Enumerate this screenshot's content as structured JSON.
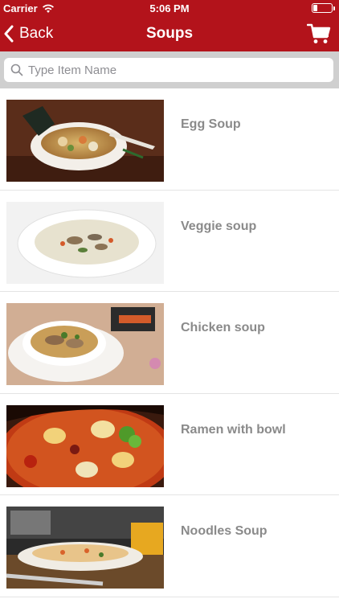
{
  "status": {
    "carrier": "Carrier",
    "time": "5:06 PM"
  },
  "nav": {
    "back_label": "Back",
    "title": "Soups",
    "cart_icon": "cart-icon"
  },
  "search": {
    "placeholder": "Type Item Name",
    "value": ""
  },
  "items": [
    {
      "label": "Egg Soup"
    },
    {
      "label": "Veggie soup"
    },
    {
      "label": "Chicken soup"
    },
    {
      "label": "Ramen with bowl"
    },
    {
      "label": "Noodles Soup"
    }
  ],
  "colors": {
    "accent": "#b3131b",
    "search_bg": "#cfcfcf",
    "item_text": "#8a8a8a"
  }
}
